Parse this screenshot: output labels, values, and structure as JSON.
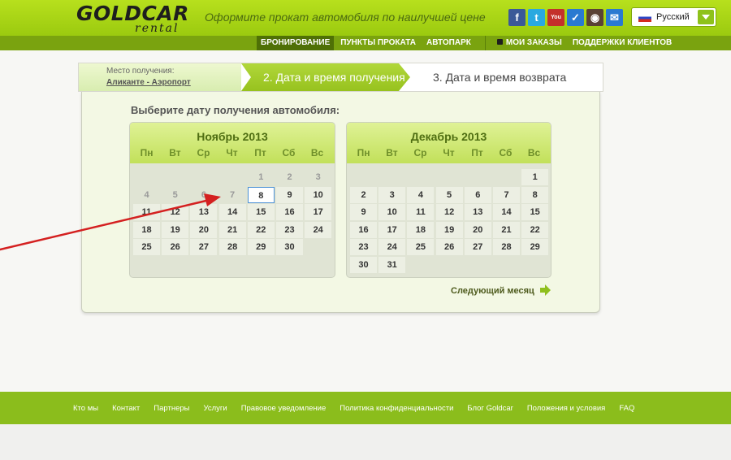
{
  "header": {
    "logo": "GOLDCAR",
    "logo_sub": "rental",
    "tagline": "Оформите прокат автомобиля по наилучшей цене",
    "social": [
      {
        "icon": "facebook-icon",
        "glyph": "f",
        "color": "#3b5998"
      },
      {
        "icon": "twitter-icon",
        "glyph": "t",
        "color": "#2aa9e0"
      },
      {
        "icon": "youtube-icon",
        "glyph": "You",
        "color": "#c4302b"
      },
      {
        "icon": "check-icon",
        "glyph": "✓",
        "color": "#2a7ad1"
      },
      {
        "icon": "instagram-icon",
        "glyph": "◉",
        "color": "#5a4235"
      },
      {
        "icon": "mail-icon",
        "glyph": "✉",
        "color": "#2a7ad1"
      }
    ],
    "language": "Русский"
  },
  "nav": {
    "items": [
      "БРОНИРОВАНИЕ",
      "ПУНКТЫ ПРОКАТА",
      "АВТОПАРК"
    ],
    "my_orders": "МОИ ЗАКАЗЫ",
    "support": "ПОДДЕРЖКИ КЛИЕНТОВ"
  },
  "steps": {
    "step1_label": "Место получения:",
    "step1_value": "Аликанте - Аэропорт",
    "step2": "2. Дата и время получения",
    "step3": "3. Дата и время возврата"
  },
  "picker": {
    "title": "Выберите дату получения автомобиля:",
    "next_month": "Следующий месяц",
    "weekdays": [
      "Пн",
      "Вт",
      "Ср",
      "Чт",
      "Пт",
      "Сб",
      "Вс"
    ],
    "selected_day": 8,
    "months": [
      {
        "title": "Ноябрь 2013",
        "first_weekday": 4,
        "days": 30,
        "past_until": 7
      },
      {
        "title": "Декабрь 2013",
        "first_weekday": 6,
        "days": 31,
        "past_until": 0
      }
    ]
  },
  "footer": {
    "links": [
      "Кто мы",
      "Контакт",
      "Партнеры",
      "Услуги",
      "Правовое уведомление",
      "Политика конфиденциальности",
      "Блог Goldcar",
      "Положения и условия",
      "FAQ"
    ]
  },
  "colors": {
    "brand_green": "#9bca0f",
    "dark_green": "#7aa30f",
    "footer_green": "#8bbd1c",
    "arrow_red": "#d42020"
  }
}
